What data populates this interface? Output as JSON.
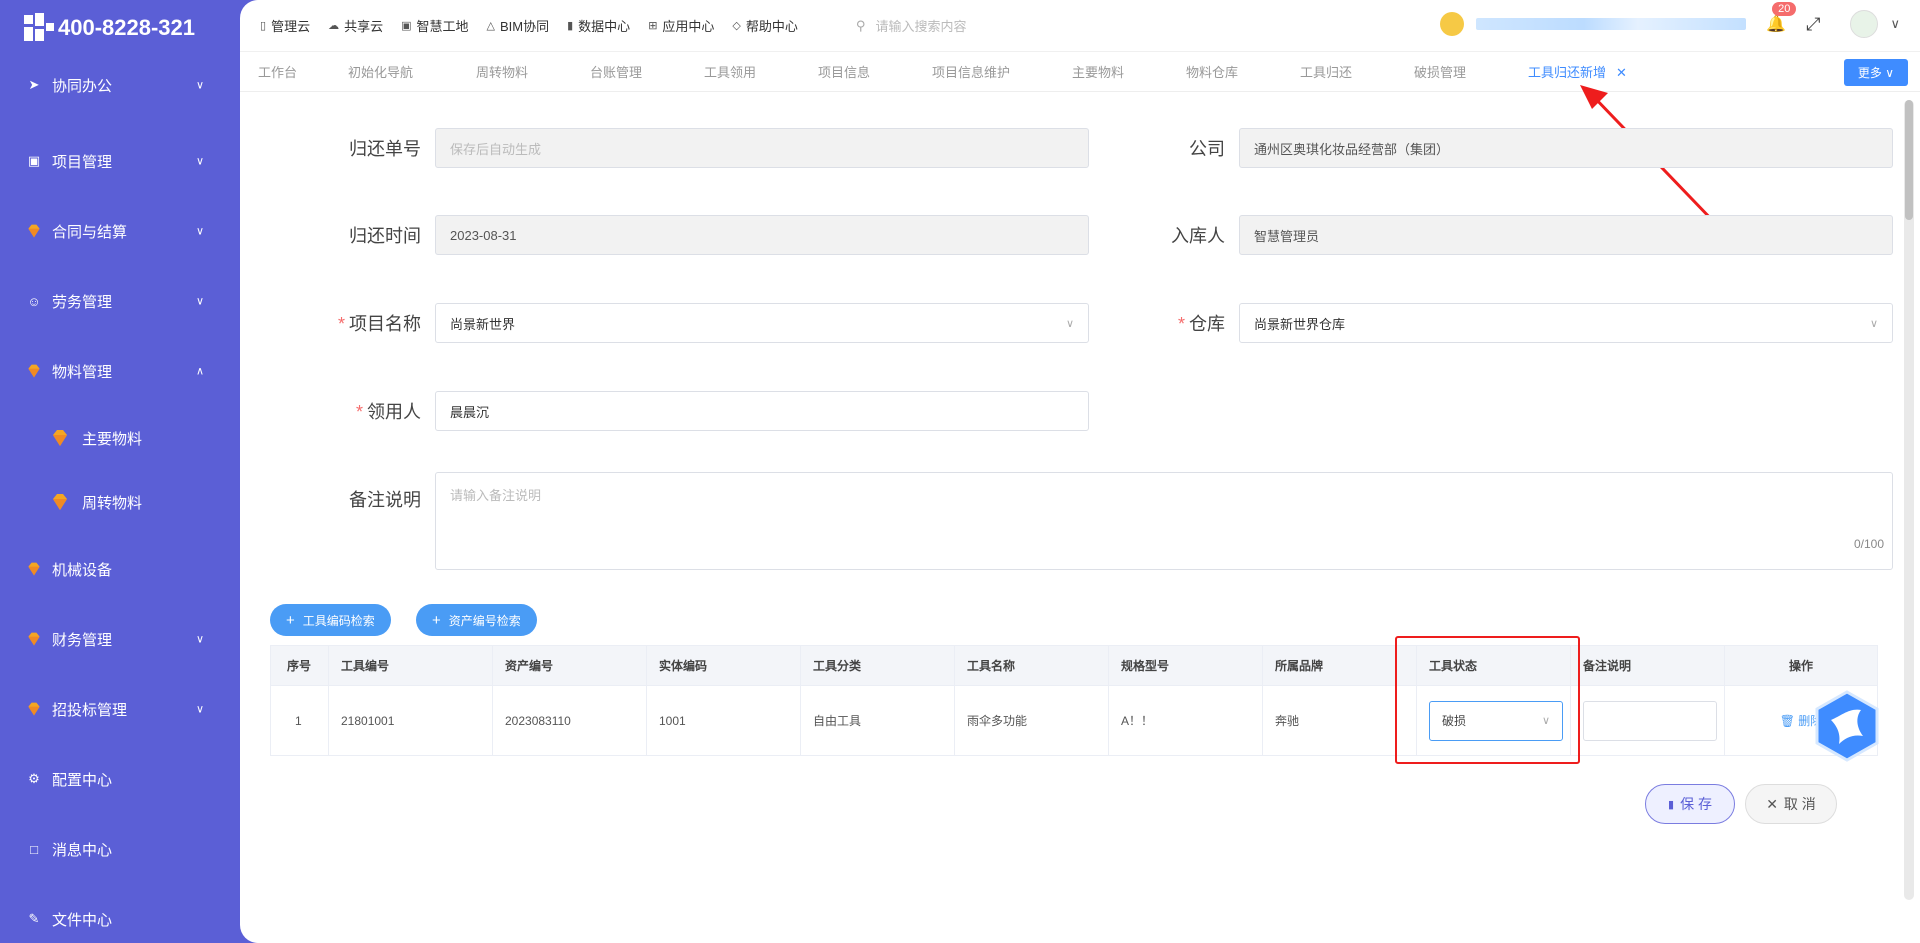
{
  "brand": {
    "phone": "400-8228-321"
  },
  "sidebar": {
    "items": [
      {
        "label": "协同办公",
        "icon": "send-icon",
        "expanded": false
      },
      {
        "label": "项目管理",
        "icon": "book-icon",
        "expanded": false
      },
      {
        "label": "合同与结算",
        "icon": "gem-icon",
        "expanded": false
      },
      {
        "label": "劳务管理",
        "icon": "user-icon",
        "expanded": false
      },
      {
        "label": "物料管理",
        "icon": "gem-icon",
        "expanded": true
      },
      {
        "label": "机械设备",
        "icon": "gem-icon",
        "expanded": false
      },
      {
        "label": "财务管理",
        "icon": "gem-icon",
        "expanded": false
      },
      {
        "label": "招投标管理",
        "icon": "gem-icon",
        "expanded": false
      },
      {
        "label": "配置中心",
        "icon": "gear-icon"
      },
      {
        "label": "消息中心",
        "icon": "message-icon"
      },
      {
        "label": "文件中心",
        "icon": "edit-icon"
      }
    ],
    "subitems": [
      {
        "label": "主要物料",
        "icon": "gem-icon"
      },
      {
        "label": "周转物料",
        "icon": "gem-icon"
      }
    ]
  },
  "topnav": {
    "items": [
      {
        "label": "管理云",
        "icon": "doc-icon"
      },
      {
        "label": "共享云",
        "icon": "cloud-icon"
      },
      {
        "label": "智慧工地",
        "icon": "book-icon"
      },
      {
        "label": "BIM协同",
        "icon": "cube-icon"
      },
      {
        "label": "数据中心",
        "icon": "chart-icon"
      },
      {
        "label": "应用中心",
        "icon": "grid-icon"
      },
      {
        "label": "帮助中心",
        "icon": "diamond-icon"
      }
    ],
    "search_placeholder": "请输入搜索内容",
    "notification_count": "20"
  },
  "tabs": {
    "items": [
      "工作台",
      "初始化导航",
      "周转物料",
      "台账管理",
      "工具领用",
      "项目信息",
      "项目信息维护",
      "主要物料",
      "物料仓库",
      "工具归还",
      "破损管理"
    ],
    "active": "工具归还新增",
    "more": "更多"
  },
  "form": {
    "return_no": {
      "label": "归还单号",
      "placeholder": "保存后自动生成"
    },
    "company": {
      "label": "公司",
      "value": "通州区奥琪化妆品经营部（集团）"
    },
    "return_time": {
      "label": "归还时间",
      "value": "2023-08-31"
    },
    "warehouser": {
      "label": "入库人",
      "value": "智慧管理员"
    },
    "project": {
      "label": "项目名称",
      "value": "尚景新世界"
    },
    "warehouse": {
      "label": "仓库",
      "value": "尚景新世界仓库"
    },
    "receiver": {
      "label": "领用人",
      "value": "晨晨沉"
    },
    "remark": {
      "label": "备注说明",
      "placeholder": "请输入备注说明",
      "count": "0/100"
    }
  },
  "actions": {
    "tool_code_search": "工具编码检索",
    "asset_code_search": "资产编号检索",
    "save": "保 存",
    "cancel": "取 消"
  },
  "table": {
    "headers": [
      "序号",
      "工具编号",
      "资产编号",
      "实体编码",
      "工具分类",
      "工具名称",
      "规格型号",
      "所属品牌",
      "工具状态",
      "备注说明",
      "操作"
    ],
    "rows": [
      {
        "index": "1",
        "tool_no": "21801001",
        "asset_no": "2023083110",
        "entity_code": "1001",
        "category": "自由工具",
        "name": "雨伞多功能",
        "spec": "A！！",
        "brand": "奔驰",
        "status": "破损",
        "remark": "",
        "action": "删除"
      }
    ]
  }
}
